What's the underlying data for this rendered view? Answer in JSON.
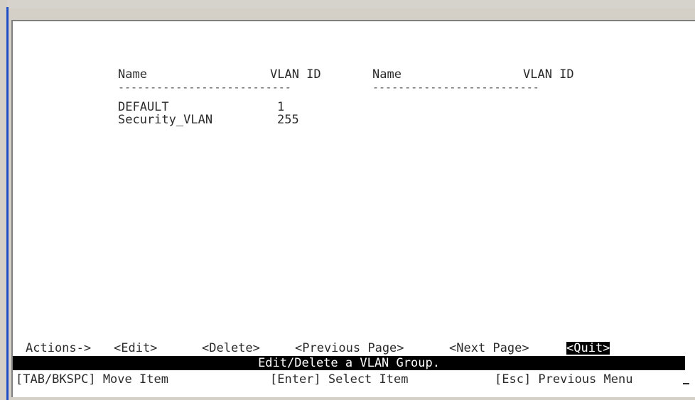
{
  "table": {
    "headers": {
      "name_left": "Name",
      "vlan_id_left": "VLAN ID",
      "name_right": "Name",
      "vlan_id_right": "VLAN ID"
    },
    "rule_left": "---------------------------",
    "rule_right": "--------------------------",
    "rows": [
      {
        "name": "DEFAULT",
        "vlan_id": "1"
      },
      {
        "name": "Security_VLAN",
        "vlan_id": "255"
      }
    ]
  },
  "actions": {
    "label": "Actions->",
    "edit": "<Edit>",
    "delete": "<Delete>",
    "previous_page": "<Previous Page>",
    "next_page": "<Next Page>",
    "quit": "<Quit>"
  },
  "help_bar": {
    "text": "Edit/Delete a VLAN Group."
  },
  "keys": {
    "move": "[TAB/BKSPC] Move Item",
    "select": "[Enter] Select Item",
    "previous_menu": "[Esc] Previous Menu"
  },
  "colors": {
    "highlight_bg": "#000000",
    "highlight_fg": "#ffffff",
    "text": "#2b2b2b"
  }
}
